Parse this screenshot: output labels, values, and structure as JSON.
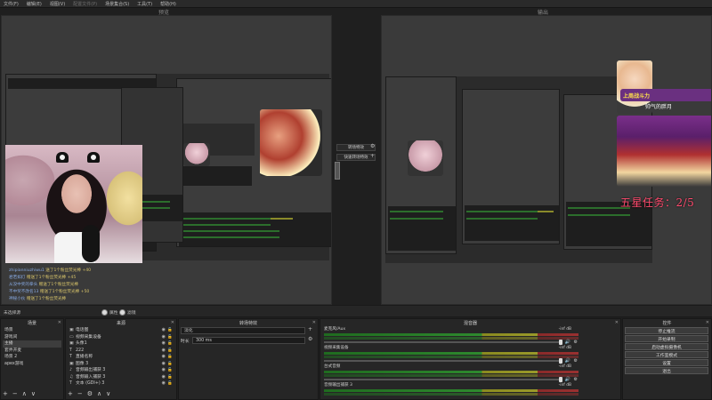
{
  "menu": {
    "items": [
      "文件(F)",
      "编辑(E)",
      "视图(V)",
      "配置文件(P)",
      "场景集合(S)",
      "工具(T)",
      "帮助(H)"
    ],
    "disabled_index": 3
  },
  "panes": {
    "preview_label": "预览",
    "program_label": "输出"
  },
  "overlay": {
    "banner_text": "上周战斗力",
    "tag_text": "帅气的胖月",
    "star_task": "五星任务：2/5"
  },
  "chat": [
    {
      "name": "zhipianniuzhiwu1",
      "text": "送了1个粉丝荧光棒 +40"
    },
    {
      "name": "君若如灯",
      "text": "赠送了1个粉丝荧光棒 +45"
    },
    {
      "name": "从没中奖的拳头",
      "text": "赠送了1个粉丝荧光棒"
    },
    {
      "name": "不中奖不改名13",
      "text": "赠送了1个粉丝荧光棒 +50"
    },
    {
      "name": "神秘小伙",
      "text": "赠送了1个粉丝荧光棒"
    }
  ],
  "transitions_mid": {
    "transition_button": "转场特效",
    "quick_transition": "快速转场特效"
  },
  "midbar": {
    "label": "未选择源",
    "toggle1": "属性",
    "toggle2": "滤镜"
  },
  "scenes": {
    "title": "场景",
    "items": [
      "场景",
      "游戏间",
      "主播",
      "套弄开麦",
      "场景 2",
      "apex游戏"
    ],
    "selected_index": 2
  },
  "sources": {
    "title": "来源",
    "items": [
      {
        "icon": "image-icon",
        "label": "电话图"
      },
      {
        "icon": "video-icon",
        "label": "视频采集设备"
      },
      {
        "icon": "image-icon",
        "label": "头像1"
      },
      {
        "icon": "text-icon",
        "label": "222"
      },
      {
        "icon": "text-icon",
        "label": "直播名称"
      },
      {
        "icon": "image-icon",
        "label": "图像 3"
      },
      {
        "icon": "speaker-icon",
        "label": "音频输出捕获 3"
      },
      {
        "icon": "mic-icon",
        "label": "音频输入捕获 3"
      },
      {
        "icon": "text-icon",
        "label": "文本 (GDI+) 3"
      }
    ]
  },
  "transition_dock": {
    "title": "转场特效",
    "select_value": "淡化",
    "duration_label": "时长",
    "duration_value": "300 ms"
  },
  "mixer": {
    "title": "混音器",
    "channels": [
      {
        "name": "麦克风/Aux",
        "db": "-inf dB"
      },
      {
        "name": "视频采集设备",
        "db": "-inf dB"
      },
      {
        "name": "台式音频",
        "db": "-inf dB"
      },
      {
        "name": "音频输出捕获 3",
        "db": "-inf dB"
      }
    ]
  },
  "controls": {
    "title": "控件",
    "buttons": [
      "停止推流",
      "开始录制",
      "启动虚拟摄像机",
      "工作室模式",
      "设置",
      "退出"
    ]
  },
  "footer_icons": [
    "+",
    "−",
    "∧",
    "∨"
  ]
}
